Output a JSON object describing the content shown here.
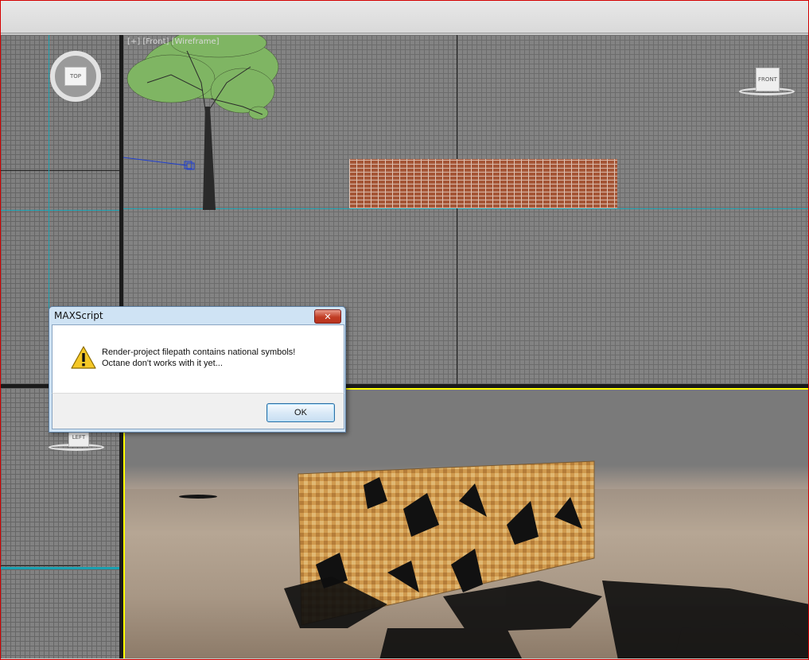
{
  "viewports": {
    "front": {
      "label": "[+] [Front] [Wireframe]",
      "viewcube": "FRONT"
    },
    "top": {
      "viewcube": "TOP"
    },
    "left": {
      "viewcube": "LEFT"
    }
  },
  "dialog": {
    "title": "MAXScript",
    "close_glyph": "✕",
    "message_line1": "Render-project filepath contains national symbols!",
    "message_line2": "Octane don't works with it yet...",
    "icon": "warning-icon",
    "ok_label": "OK"
  },
  "colors": {
    "active_viewport_border": "#ffff00",
    "window_border": "#d40000",
    "grid_axis": "#1aa0b0"
  }
}
